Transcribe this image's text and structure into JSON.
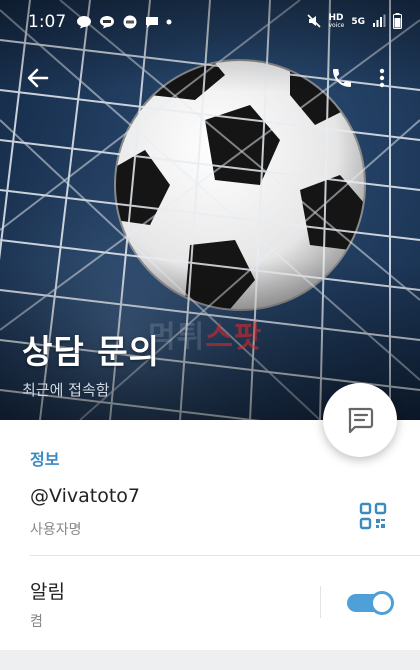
{
  "status_bar": {
    "time": "1:07",
    "notif_icons": [
      "chat-bubble-icon",
      "talk-icon",
      "sms-icon",
      "message-icon",
      "dot-icon"
    ],
    "hd_label": "HD",
    "hd_sub": "voice",
    "net_label": "5G",
    "battery_icon": "battery-icon",
    "signal_icon": "signal-icon"
  },
  "toolbar": {
    "back_icon": "arrow-left-icon",
    "call_icon": "phone-icon",
    "menu_icon": "more-vertical-icon"
  },
  "profile": {
    "name": "상담 문의",
    "last_seen": "최근에 접속함",
    "watermark_white": "먹튀",
    "watermark_red": "스팟"
  },
  "info": {
    "section_title": "정보",
    "username": "@Vivatoto7",
    "username_label": "사용자명",
    "notifications": "알림",
    "notifications_state": "켬",
    "notifications_on": true
  },
  "colors": {
    "accent": "#3b8bc2",
    "toggle": "#4f9fd9"
  }
}
